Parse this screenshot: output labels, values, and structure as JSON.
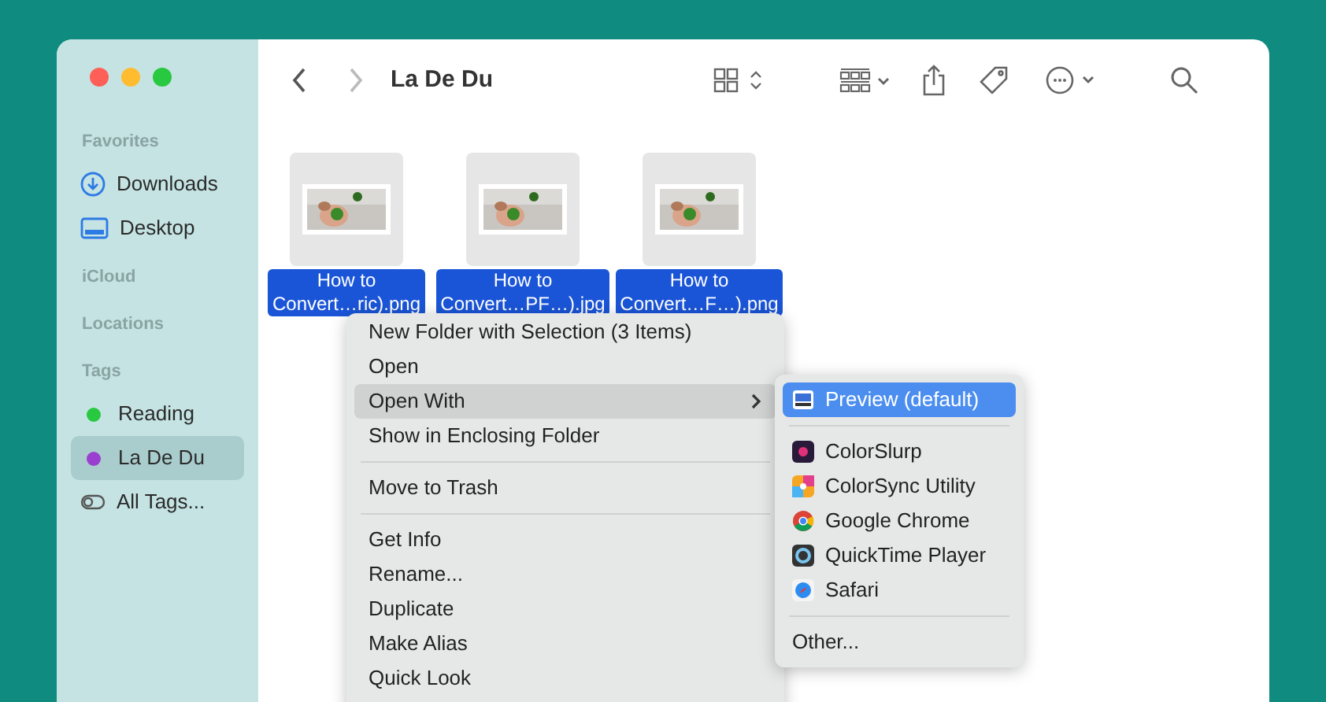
{
  "window": {
    "title": "La De Du"
  },
  "sidebar": {
    "sections": [
      {
        "heading": "Favorites",
        "items": [
          {
            "label": "Downloads",
            "kind": "downloads",
            "selected": false
          },
          {
            "label": "Desktop",
            "kind": "desktop",
            "selected": false
          }
        ]
      },
      {
        "heading": "iCloud"
      },
      {
        "heading": "Locations"
      },
      {
        "heading": "Tags",
        "items": [
          {
            "label": "Reading",
            "kind": "tag",
            "color": "#28c940",
            "selected": false
          },
          {
            "label": "La De Du",
            "kind": "tag",
            "color": "#9b3fd0",
            "selected": true
          },
          {
            "label": "All Tags...",
            "kind": "alltags",
            "selected": false
          }
        ]
      }
    ]
  },
  "files": [
    {
      "line1": "How to",
      "line2": "Convert…ric).png",
      "selected": true
    },
    {
      "line1": "How to",
      "line2": "Convert…PF…).jpg",
      "selected": true
    },
    {
      "line1": "How to",
      "line2": "Convert…F…).png",
      "selected": true
    }
  ],
  "context_menu": {
    "groups": [
      [
        {
          "label": "New Folder with Selection (3 Items)",
          "selected": false
        },
        {
          "label": "Open",
          "selected": false
        },
        {
          "label": "Open With",
          "selected": true,
          "submenu": true
        },
        {
          "label": "Show in Enclosing Folder",
          "selected": false
        }
      ],
      [
        {
          "label": "Move to Trash",
          "selected": false
        }
      ],
      [
        {
          "label": "Get Info",
          "selected": false
        },
        {
          "label": "Rename...",
          "selected": false
        },
        {
          "label": "Duplicate",
          "selected": false
        },
        {
          "label": "Make Alias",
          "selected": false
        },
        {
          "label": "Quick Look",
          "selected": false
        }
      ]
    ]
  },
  "submenu": {
    "groups": [
      [
        {
          "label": "Preview (default)",
          "kind": "preview",
          "selected": true
        }
      ],
      [
        {
          "label": "ColorSlurp",
          "kind": "colorslurp",
          "selected": false
        },
        {
          "label": "ColorSync Utility",
          "kind": "colorsync",
          "selected": false
        },
        {
          "label": "Google Chrome",
          "kind": "chrome",
          "selected": false
        },
        {
          "label": "QuickTime Player",
          "kind": "quicktime",
          "selected": false
        },
        {
          "label": "Safari",
          "kind": "safari",
          "selected": false
        }
      ],
      [
        {
          "label": "Other...",
          "selected": false
        }
      ]
    ]
  }
}
